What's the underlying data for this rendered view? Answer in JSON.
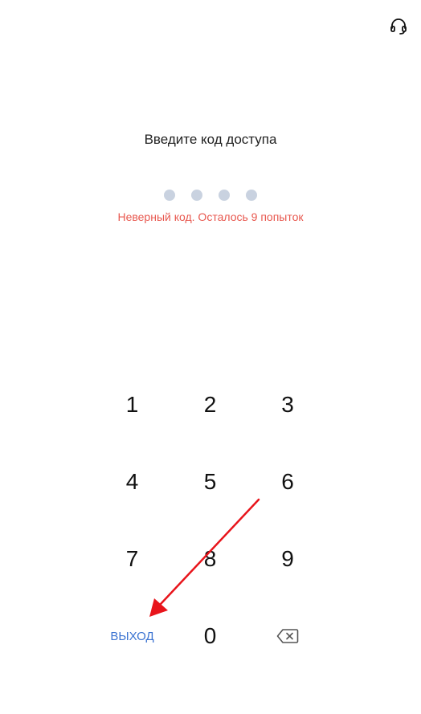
{
  "header": {
    "support_icon": "headset-icon"
  },
  "prompt": "Введите код доступа",
  "pin": {
    "length": 4,
    "dot_color": "#c9d2e0"
  },
  "error_message": "Неверный код. Осталось 9 попыток",
  "error_color": "#e8584f",
  "keypad": {
    "keys": [
      "1",
      "2",
      "3",
      "4",
      "5",
      "6",
      "7",
      "8",
      "9"
    ],
    "exit_label": "ВЫХОД",
    "zero_label": "0",
    "backspace_icon": "backspace-icon",
    "accent_color": "#3b73d1"
  },
  "annotation": {
    "arrow_icon": "red-arrow-icon",
    "arrow_color": "#e8141b"
  }
}
